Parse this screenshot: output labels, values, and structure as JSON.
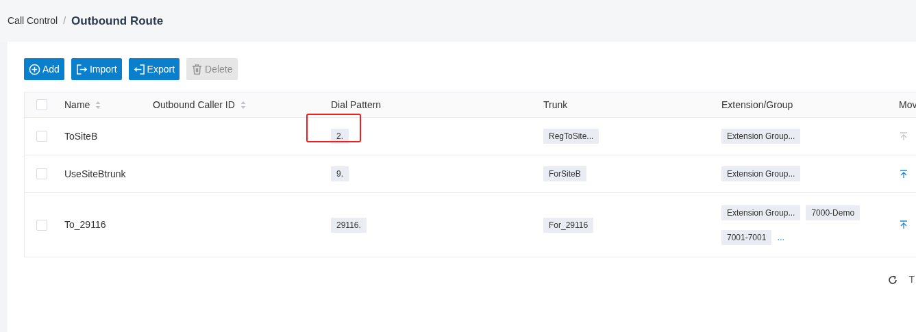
{
  "breadcrumb": {
    "parent": "Call Control",
    "separator": "/",
    "current": "Outbound Route"
  },
  "toolbar": [
    {
      "kind": "add",
      "label": "Add",
      "disabled": false
    },
    {
      "kind": "import",
      "label": "Import",
      "disabled": false
    },
    {
      "kind": "export",
      "label": "Export",
      "disabled": false
    },
    {
      "kind": "delete",
      "label": "Delete",
      "disabled": true
    }
  ],
  "table": {
    "all_checked": false,
    "columns": [
      {
        "label": "Name",
        "sortable": true
      },
      {
        "label": "Outbound Caller ID",
        "sortable": true
      },
      {
        "label": "Dial Pattern",
        "sortable": false
      },
      {
        "label": "Trunk",
        "sortable": false
      },
      {
        "label": "Extension/Group",
        "sortable": false
      },
      {
        "label": "Mov",
        "sortable": false
      }
    ],
    "rows": [
      {
        "checked": false,
        "name": "ToSiteB",
        "dial_pattern": "2.",
        "dial_pattern_highlighted": true,
        "trunk": "RegToSite...",
        "extensions": [
          "Extension Group..."
        ],
        "move_top_disabled": true
      },
      {
        "checked": false,
        "name": "UseSiteBtrunk",
        "dial_pattern": "9.",
        "dial_pattern_highlighted": false,
        "trunk": "ForSiteB",
        "extensions": [
          "Extension Group..."
        ],
        "move_top_disabled": false
      },
      {
        "checked": false,
        "name": "To_29116",
        "dial_pattern": "29116.",
        "dial_pattern_highlighted": false,
        "trunk": "For_29116",
        "extensions": [
          "Extension Group...",
          "7000-Demo",
          "7001-7001"
        ],
        "more": "...",
        "move_top_disabled": false
      }
    ]
  },
  "footer": {
    "text": "T"
  }
}
